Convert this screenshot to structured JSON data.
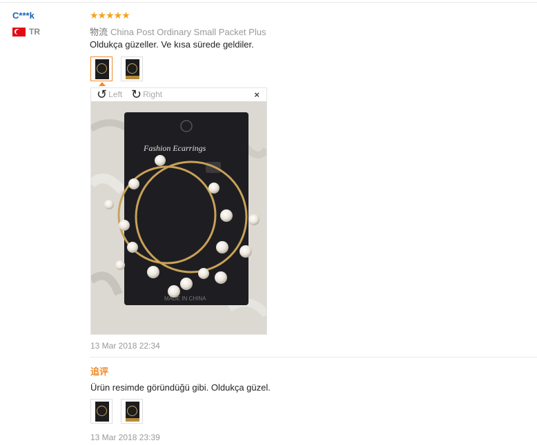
{
  "user": {
    "name": "C***k",
    "country_code": "TR",
    "flag_icon": "turkey-flag-icon"
  },
  "review": {
    "stars": "★★★★★",
    "logistics_label": "物流",
    "logistics_value": "China Post Ordinary Small Packet Plus",
    "feedback": "Oldukça güzeller. Ve kısa sürede geldiler.",
    "date": "13 Mar 2018 22:34"
  },
  "viewer": {
    "rotate_left_label": "Left",
    "rotate_right_label": "Right",
    "close_label": "×",
    "card_title": "Fashion Ecarrings",
    "card_footer": "MADE IN CHINA"
  },
  "additional": {
    "label": "追评",
    "feedback": "Ürün resimde göründüğü gibi. Oldukça güzel.",
    "date": "13 Mar 2018 23:39"
  },
  "colors": {
    "accent": "#f08b2a",
    "link": "#1a64b7",
    "star": "#f7a21b"
  }
}
